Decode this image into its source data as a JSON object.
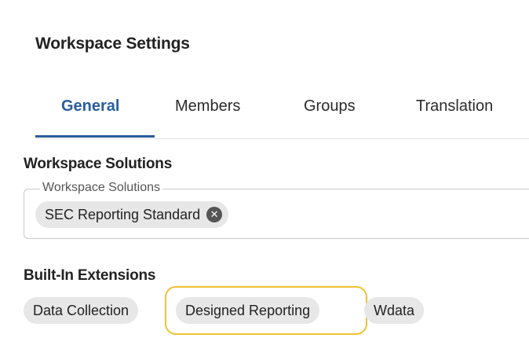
{
  "header": {
    "title": "Workspace Settings"
  },
  "tabs": [
    {
      "label": "General",
      "active": true
    },
    {
      "label": "Members",
      "active": false
    },
    {
      "label": "Groups",
      "active": false
    },
    {
      "label": "Translation",
      "active": false
    }
  ],
  "workspace_solutions": {
    "section_title": "Workspace Solutions",
    "field_label": "Workspace Solutions",
    "chips": [
      {
        "label": "SEC Reporting Standard",
        "remove_icon": "close-circle-icon"
      }
    ]
  },
  "built_in_extensions": {
    "section_title": "Built-In Extensions",
    "chips": [
      {
        "label": "Data Collection",
        "highlighted": false
      },
      {
        "label": "Designed Reporting",
        "highlighted": true
      },
      {
        "label": "Wdata",
        "highlighted": false
      }
    ]
  },
  "colors": {
    "accent": "#2a5d9c",
    "chip_bg": "#e7e7e7",
    "highlight": "#f0c232"
  }
}
